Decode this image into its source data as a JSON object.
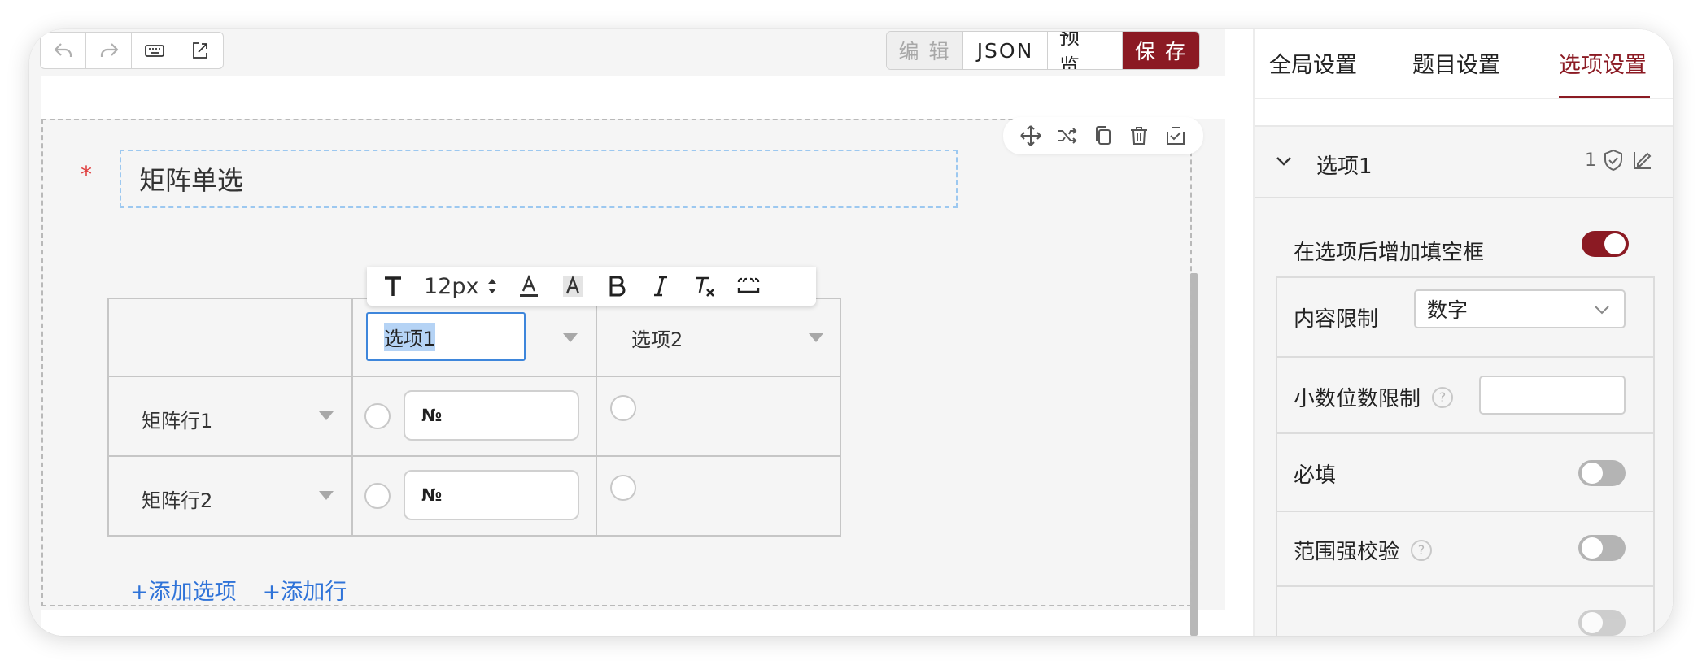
{
  "toolbar": {
    "icons": [
      "undo-icon",
      "redo-icon",
      "keyboard-icon",
      "export-icon"
    ],
    "modes": {
      "edit": "编 辑",
      "json": "JSON",
      "preview": "预 览",
      "save": "保 存"
    }
  },
  "question": {
    "required_mark": "*",
    "title": "矩阵单选",
    "actions": [
      "move-icon",
      "shuffle-icon",
      "copy-icon",
      "delete-icon",
      "save-template-icon"
    ]
  },
  "format_bar": {
    "font_size": "12px",
    "tools": [
      "text-icon",
      "font-color-icon",
      "highlight-icon",
      "bold-icon",
      "italic-icon",
      "clear-format-icon",
      "blank-fill-icon"
    ]
  },
  "matrix": {
    "columns": [
      "选项1",
      "选项2"
    ],
    "rows": [
      {
        "label": "矩阵行1",
        "blank_value": "№"
      },
      {
        "label": "矩阵行2",
        "blank_value": "№"
      }
    ],
    "add_option": "+添加选项",
    "add_row": "+添加行"
  },
  "panel": {
    "tabs": [
      "全局设置",
      "题目设置",
      "选项设置"
    ],
    "active_tab": "选项设置",
    "group": {
      "title": "选项1",
      "count": "1"
    },
    "fill_toggle": {
      "label": "在选项后增加填空框",
      "on": true
    },
    "content_limit": {
      "label": "内容限制",
      "value": "数字"
    },
    "decimal_limit": {
      "label": "小数位数限制",
      "value": ""
    },
    "required": {
      "label": "必填",
      "on": false
    },
    "range_check": {
      "label": "范围强校验",
      "on": false
    }
  },
  "colors": {
    "brand": "#8b1a23",
    "link": "#2f73d8",
    "selection": "#3e86db"
  }
}
